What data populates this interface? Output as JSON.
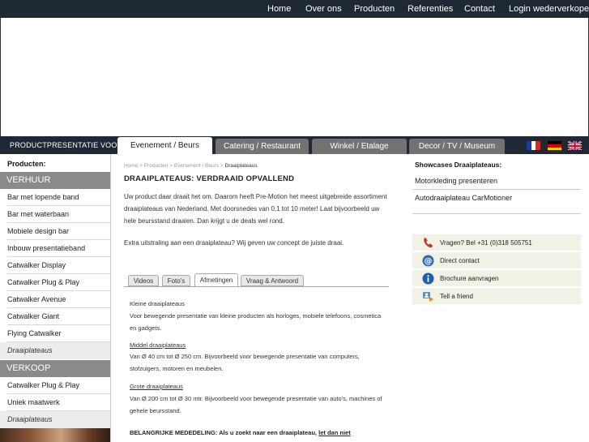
{
  "topnav": {
    "items": [
      "Home",
      "Over ons",
      "Producten",
      "Referenties",
      "Contact",
      "Login wederverkopers"
    ]
  },
  "categories": {
    "label": "PRODUCTPRESENTATIE VOOR:",
    "tabs": [
      "Evenement / Beurs",
      "Catering / Restaurant",
      "Winkel / Etalage",
      "Decor / TV / Museum"
    ],
    "active": "Evenement / Beurs"
  },
  "languages": [
    "french-flag-icon",
    "german-flag-icon",
    "british-flag-icon"
  ],
  "sidebar": {
    "heading": "Producten:",
    "section_verhuur": "VERHUUR",
    "verhuur_items": [
      "Bar met lopende band",
      "Bar met waterbaan",
      "Mobiele design bar",
      "Inbouw presentatieband",
      "Catwalker Display",
      "Catwalker Plug & Play",
      "Catwalker Avenue",
      "Catwalker Giant",
      "Flying Catwalker",
      "Draaiplateaus"
    ],
    "section_verkoop": "VERKOOP",
    "verkoop_items": [
      "Catwalker Plug & Play",
      "Uniek maatwerk",
      "Draaiplateaus"
    ]
  },
  "breadcrumb": {
    "items": [
      "Home",
      "Producten",
      "Evenement / Beurs"
    ],
    "separator": ">",
    "current": "Draaiplateaus"
  },
  "main": {
    "title": "DRAAIPLATEAUS: VERDRAAID OPVALLEND",
    "intro1": "Uw product daar draait het om. Daarom heeft Pre-Motion het meest uitgebreide assortiment draaiplateaus van Nederland. Met doorsnedes van 0,1 tot 10 meter! Laat bijvoorbeeld uw hele beursstand draaien. Dan krijgt u de deals wel rond.",
    "intro2": "Extra uitstraling aan een draaiplateau? Wij geven uw concept de juiste draai.",
    "tabs": [
      "Videos",
      "Foto's",
      "Afmetingen",
      "Vraag & Antwoord"
    ],
    "active_tab": "Afmetingen",
    "small_title": "Kleine draaiplateaus",
    "small_text": "Voor bewegende presentatie van kleine producten als horloges, mobiele telefoons, cosmetica en gadgets.",
    "medium_title": "Middel draaiplateaus",
    "medium_text": "Van Ø 40 cm tot Ø 250 cm. Bijvoorbeeld voor bewegende presentatie van computers, stofzuigers, motoren en meubelen.",
    "large_title": "Grote draaiplateaus",
    "large_text": "Van Ø 200 cm tot Ø 30 mtr. Bijvoorbeeld voor bewegende presentatie van auto's, machines of gehele beursstand.",
    "notice_label": "BELANGRIJKE MEDEDELING: Als u zoekt naar een draaiplateau,",
    "notice_link": "let dan niet"
  },
  "right": {
    "heading": "Showcases Draaiplateaus:",
    "links": [
      "Motorkleding presenteren",
      "Autodraaiplateau CarMotioner"
    ],
    "contact": [
      {
        "icon": "phone-icon",
        "label": "Vragen? Bel +31 (0)318 505751"
      },
      {
        "icon": "at-sign-icon",
        "label": "Direct contact"
      },
      {
        "icon": "info-icon",
        "label": "Brochure aanvragen"
      },
      {
        "icon": "tell-a-friend-icon",
        "label": "Tell a friend"
      }
    ]
  }
}
